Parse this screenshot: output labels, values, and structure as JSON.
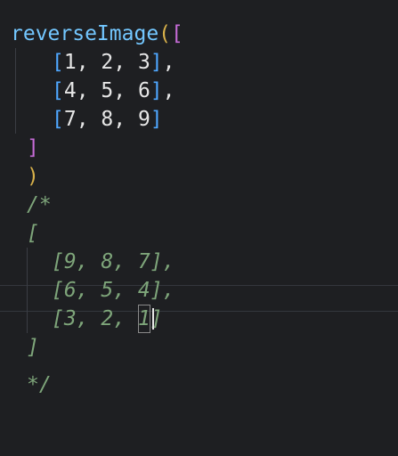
{
  "editor": {
    "lines": [
      {
        "fn": "reverseImage",
        "open_paren": "(",
        "open_bracket": "["
      },
      {
        "open": "[",
        "content": "1, 2, 3",
        "close": "]",
        "comma": ","
      },
      {
        "open": "[",
        "content": "4, 5, 6",
        "close": "]",
        "comma": ","
      },
      {
        "open": "[",
        "content": "7, 8, 9",
        "close": "]"
      },
      {
        "close_bracket": "]"
      },
      {
        "close_paren": ")"
      },
      {
        "comment_open": "/*"
      },
      {
        "comment": "["
      },
      {
        "comment": "[9, 8, 7],"
      },
      {
        "comment": "[6, 5, 4],"
      },
      {
        "comment_start": "[3, 2, ",
        "comment_cursor_char": "1",
        "comment_end": "]"
      },
      {
        "comment": "]"
      },
      {
        "comment_close": "*/"
      }
    ]
  }
}
